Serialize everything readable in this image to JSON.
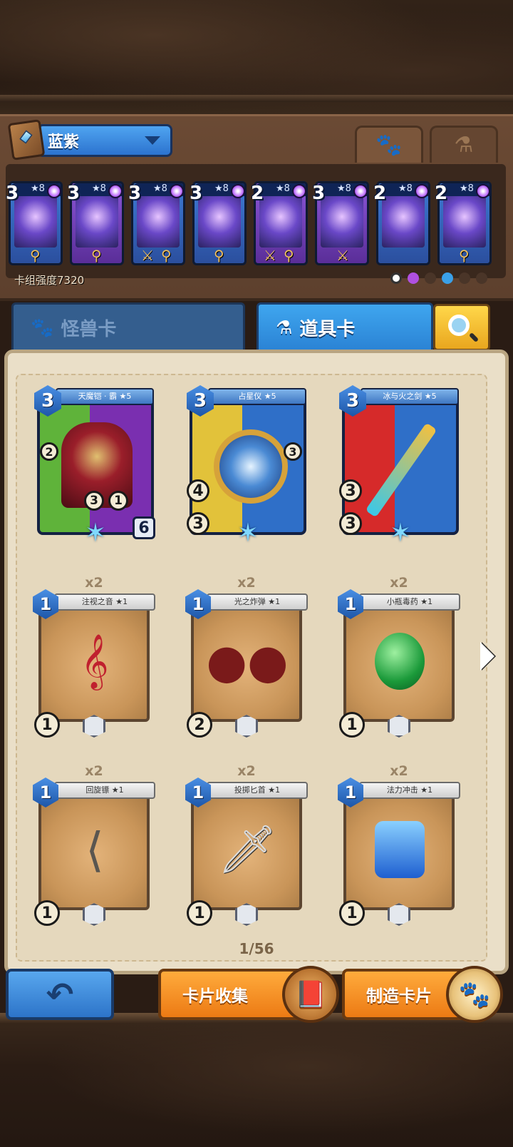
{
  "deck": {
    "name": "蓝紫",
    "power_label": "卡组强度7320",
    "tabs": [
      {
        "icon": "paw-icon",
        "active": true
      },
      {
        "icon": "potion-icon",
        "active": false
      }
    ],
    "cards": [
      {
        "cost": "3",
        "stars": "★8",
        "color": "blue",
        "tools": [
          "hook"
        ]
      },
      {
        "cost": "3",
        "stars": "★8",
        "color": "purple",
        "tools": [
          "hook"
        ]
      },
      {
        "cost": "3",
        "stars": "★8",
        "color": "blue",
        "tools": [
          "sword",
          "hook"
        ]
      },
      {
        "cost": "3",
        "stars": "★8",
        "color": "blue",
        "tools": [
          "hook"
        ]
      },
      {
        "cost": "2",
        "stars": "★8",
        "color": "purple",
        "tools": [
          "sword",
          "hook"
        ]
      },
      {
        "cost": "3",
        "stars": "★8",
        "color": "purple",
        "tools": [
          "sword"
        ]
      },
      {
        "cost": "2",
        "stars": "★8",
        "color": "blue",
        "tools": []
      },
      {
        "cost": "2",
        "stars": "★8",
        "color": "blue",
        "tools": [
          "hook"
        ]
      }
    ]
  },
  "categories": {
    "monster_label": "怪兽卡",
    "item_label": "道具卡",
    "active": "item"
  },
  "featured_cards": [
    {
      "name": "天魔铠 · 霸 ★5",
      "cost": "3",
      "stats": [
        "2",
        "3",
        "1",
        "6"
      ],
      "theme": "purple"
    },
    {
      "name": "占星仪 ★5",
      "cost": "3",
      "stats": [
        "3",
        "4",
        "3"
      ],
      "theme": "gold"
    },
    {
      "name": "冰与火之剑 ★5",
      "cost": "3",
      "stats": [
        "3",
        "3"
      ],
      "theme": "red"
    }
  ],
  "item_cards": [
    {
      "name": "注视之音 ★1",
      "count": "x2",
      "cost": "1",
      "level": "1",
      "art": "harp"
    },
    {
      "name": "光之炸弹 ★1",
      "count": "x2",
      "cost": "1",
      "level": "2",
      "art": "bombs"
    },
    {
      "name": "小瓶毒药 ★1",
      "count": "x2",
      "cost": "1",
      "level": "1",
      "art": "potion"
    },
    {
      "name": "回旋镖 ★1",
      "count": "x2",
      "cost": "1",
      "level": "1",
      "art": "boomerang"
    },
    {
      "name": "投掷匕首 ★1",
      "count": "x2",
      "cost": "1",
      "level": "1",
      "art": "dagger"
    },
    {
      "name": "法力冲击 ★1",
      "count": "x2",
      "cost": "1",
      "level": "1",
      "art": "mana"
    }
  ],
  "pagination": {
    "text": "1/56"
  },
  "buttons": {
    "collect_label": "卡片收集",
    "craft_label": "制造卡片"
  },
  "colors": {
    "accent_blue": "#3fa6ef",
    "accent_orange": "#ec7a14",
    "search_yellow": "#ffd74a"
  }
}
